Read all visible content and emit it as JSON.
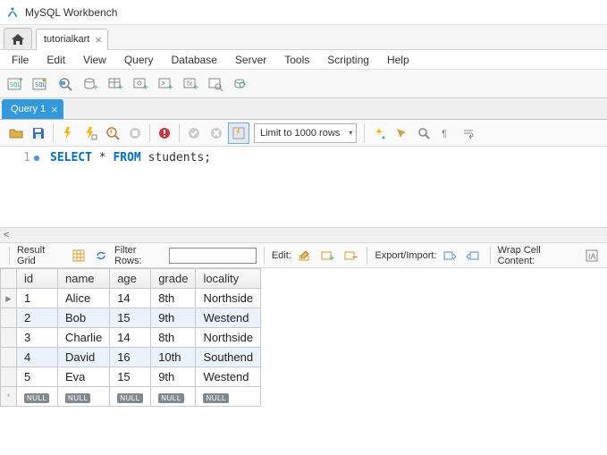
{
  "titlebar": {
    "title": "MySQL Workbench"
  },
  "conn_tab": {
    "label": "tutorialkart"
  },
  "menu": {
    "items": [
      "File",
      "Edit",
      "View",
      "Query",
      "Database",
      "Server",
      "Tools",
      "Scripting",
      "Help"
    ]
  },
  "query_tab": {
    "label": "Query 1"
  },
  "limit_rows": {
    "label": "Limit to 1000 rows"
  },
  "editor": {
    "line_no": "1",
    "kw_select": "SELECT",
    "star": " * ",
    "kw_from": "FROM",
    "rest": " students;"
  },
  "scroll_hint": "<",
  "result_bar": {
    "result_grid": "Result Grid",
    "filter_rows": "Filter Rows:",
    "edit": "Edit:",
    "export_import": "Export/Import:",
    "wrap_cell": "Wrap Cell Content:"
  },
  "columns": [
    "id",
    "name",
    "age",
    "grade",
    "locality"
  ],
  "rows": [
    {
      "id": "1",
      "name": "Alice",
      "age": "14",
      "grade": "8th",
      "locality": "Northside"
    },
    {
      "id": "2",
      "name": "Bob",
      "age": "15",
      "grade": "9th",
      "locality": "Westend"
    },
    {
      "id": "3",
      "name": "Charlie",
      "age": "14",
      "grade": "8th",
      "locality": "Northside"
    },
    {
      "id": "4",
      "name": "David",
      "age": "16",
      "grade": "10th",
      "locality": "Southend"
    },
    {
      "id": "5",
      "name": "Eva",
      "age": "15",
      "grade": "9th",
      "locality": "Westend"
    }
  ],
  "null_text": "NULL"
}
